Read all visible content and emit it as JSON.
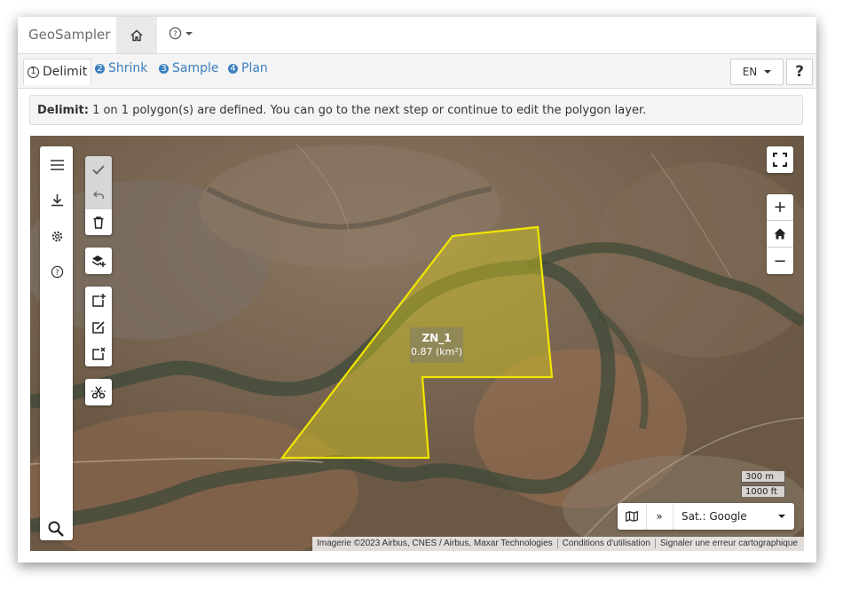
{
  "app": {
    "title": "GeoSampler"
  },
  "nav": {
    "home_icon": "home-icon",
    "help_icon": "help-circle-icon"
  },
  "tabs": [
    {
      "num": "1",
      "label": "Delimit",
      "active": true
    },
    {
      "num": "2",
      "label": "Shrink",
      "active": false
    },
    {
      "num": "3",
      "label": "Sample",
      "active": false
    },
    {
      "num": "4",
      "label": "Plan",
      "active": false
    }
  ],
  "language": {
    "selected": "EN"
  },
  "help_button": {
    "label": "?"
  },
  "info": {
    "step": "Delimit:",
    "message": "1 on 1 polygon(s) are defined. You can go to the next step or continue to edit the polygon layer."
  },
  "map": {
    "polygon": {
      "name": "ZN_1",
      "area": "0.87 (km²)",
      "stroke": "#f2e600",
      "fill": "#d8cc20"
    },
    "scale": {
      "metric": "300 m",
      "imperial": "1000 ft"
    },
    "basemap": {
      "expand_label": "»",
      "selected": "Sat.: Google"
    },
    "attribution": {
      "imagery": "Imagerie ©2023 Airbus, CNES / Airbus, Maxar Technologies",
      "terms": "Conditions d'utilisation",
      "report": "Signaler une erreur cartographique"
    },
    "zoom": {
      "in": "+",
      "out": "−"
    }
  },
  "colors": {
    "accent": "#3b7fbf",
    "map_bg": "#6e5b4a"
  }
}
